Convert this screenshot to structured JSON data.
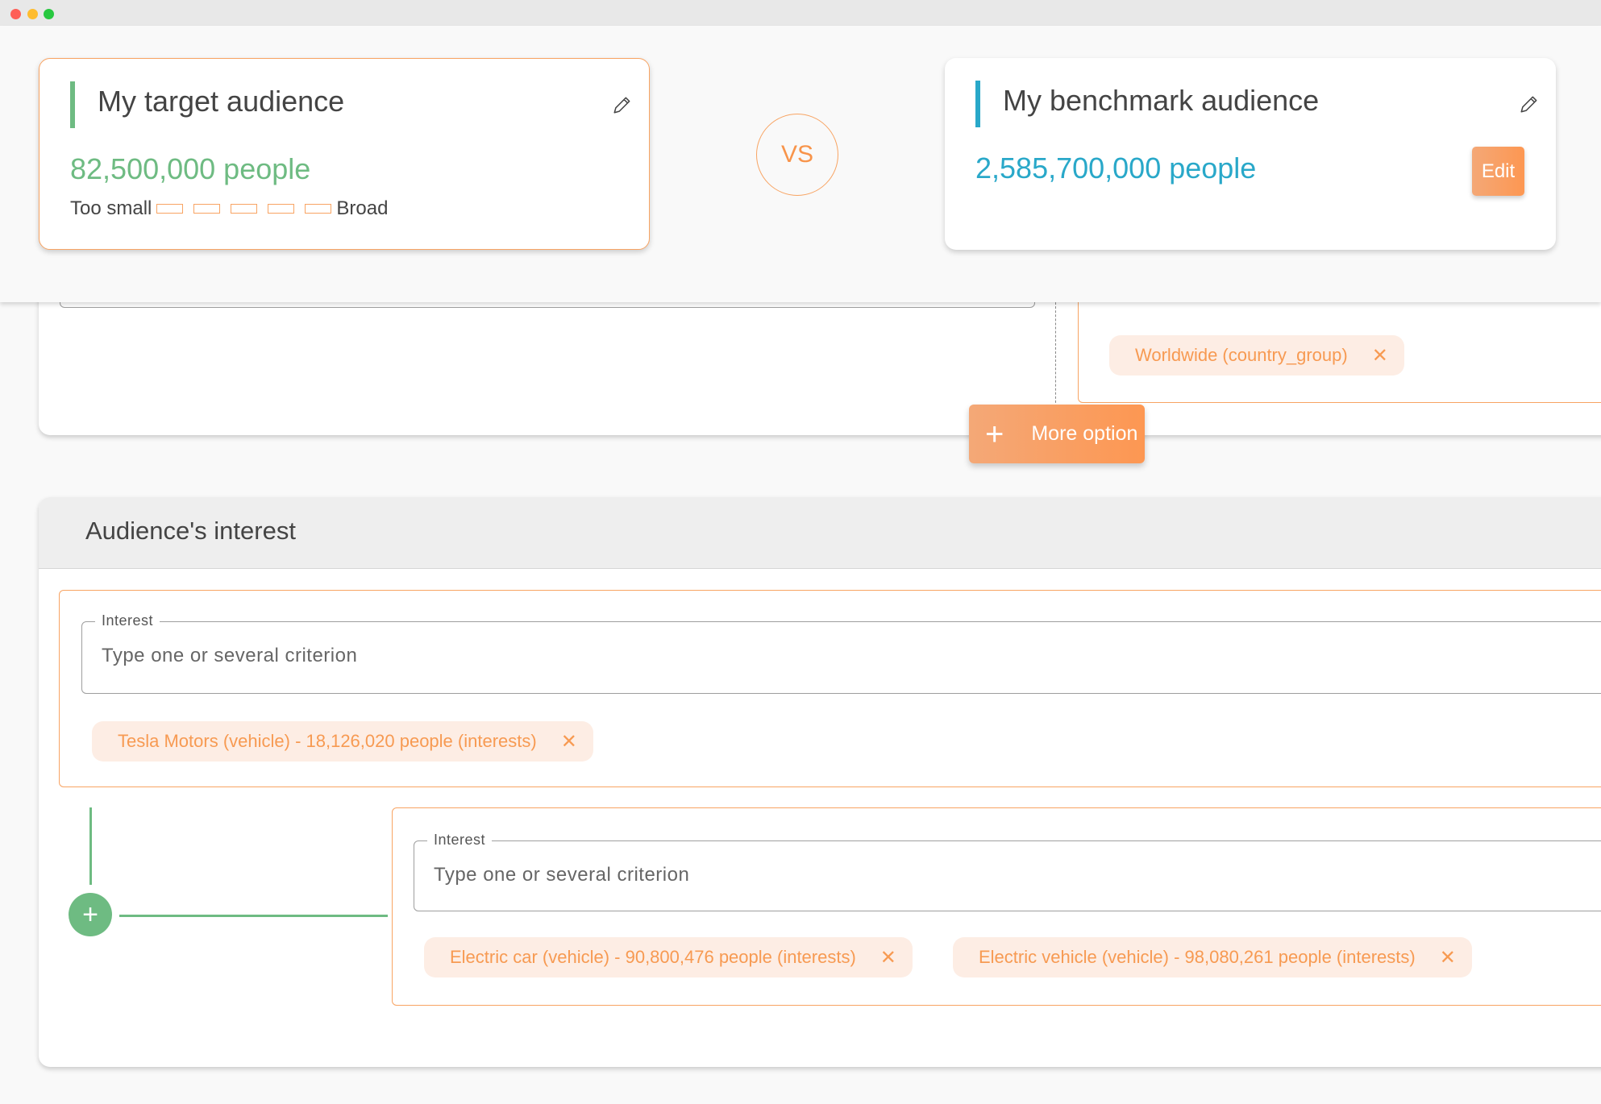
{
  "window": {
    "controls": [
      "close",
      "minimize",
      "maximize"
    ]
  },
  "header": {
    "target": {
      "title": "My target audience",
      "count": "82,500,000 people",
      "accent_color": "#6ebb82",
      "scale": {
        "min_label": "Too small",
        "max_label": "Broad",
        "segments": 5,
        "filled": 0
      },
      "edit_icon": "pencil-icon"
    },
    "vs_label": "VS",
    "benchmark": {
      "title": "My benchmark audience",
      "count": "2,585,700,000 people",
      "accent_color": "#29a8c9",
      "edit_button_label": "Edit",
      "edit_icon": "pencil-icon"
    }
  },
  "location_section": {
    "chips": [
      {
        "label": "Worldwide (country_group)",
        "remove": "✕"
      }
    ],
    "more_option_label": "More option",
    "more_option_icon": "+"
  },
  "interest_section": {
    "title": "Audience's interest",
    "groups": [
      {
        "field_label": "Interest",
        "placeholder": "Type one or several criterion",
        "value": "",
        "chips": [
          {
            "label": "Tesla Motors (vehicle) - 18,126,020 people (interests)",
            "remove": "✕"
          }
        ]
      },
      {
        "field_label": "Interest",
        "placeholder": "Type one or several criterion",
        "value": "",
        "chips": [
          {
            "label": "Electric car (vehicle) - 90,800,476 people (interests)",
            "remove": "✕"
          },
          {
            "label": "Electric vehicle (vehicle) - 98,080,261 people (interests)",
            "remove": "✕"
          }
        ]
      }
    ],
    "add_group_icon": "+"
  },
  "colors": {
    "brand_orange": "#f8a463",
    "chip_bg": "#fdede4",
    "chip_text": "#f79a52",
    "green": "#6ebb82",
    "blue": "#29a8c9"
  }
}
